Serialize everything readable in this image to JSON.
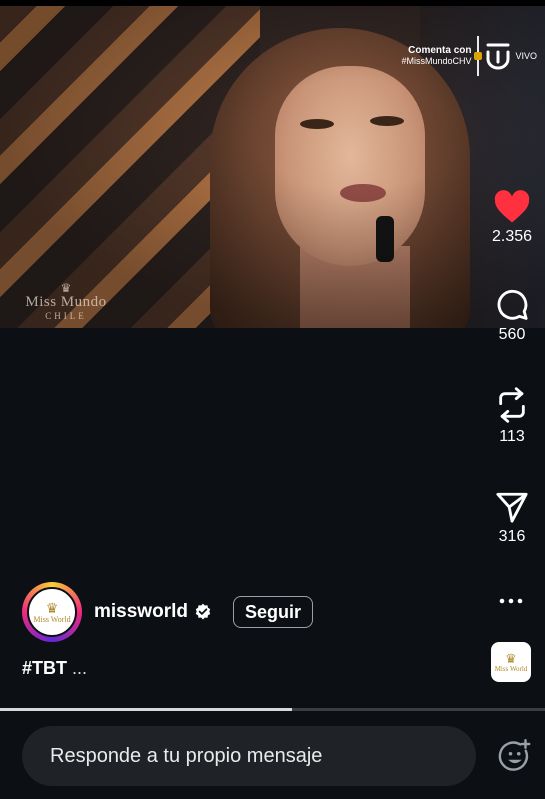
{
  "video": {
    "watermark": {
      "line1": "Miss Mundo",
      "line2": "CHILE"
    },
    "broadcast": {
      "line1": "Comenta con",
      "line2": "#MissMundoCHV",
      "live": "VIVO"
    },
    "progress": 0.535
  },
  "actions": {
    "likes": "2.356",
    "comments": "560",
    "reposts": "113",
    "shares": "316"
  },
  "author": {
    "avatar_text": "Miss World",
    "username": "missworld",
    "follow_label": "Seguir"
  },
  "caption": {
    "text": "#TBT",
    "more": "..."
  },
  "audio": {
    "text": "Miss World"
  },
  "reply": {
    "placeholder": "Responde a tu propio mensaje"
  },
  "colors": {
    "like": "#ff3040",
    "background": "#0c1014",
    "input": "#1f2328"
  },
  "icons": [
    "heart-icon",
    "comment-icon",
    "repost-icon",
    "send-icon",
    "more-icon",
    "verified-icon",
    "emoji-icon"
  ]
}
